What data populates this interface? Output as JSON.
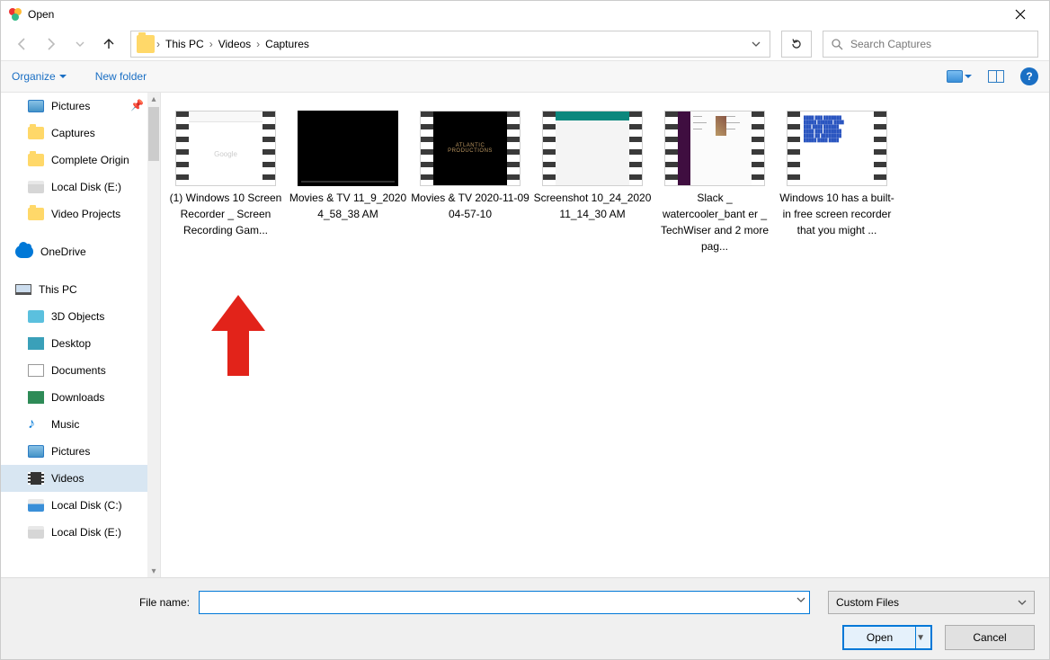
{
  "window": {
    "title": "Open"
  },
  "address": {
    "crumbs": [
      "This PC",
      "Videos",
      "Captures"
    ]
  },
  "search": {
    "placeholder": "Search Captures"
  },
  "toolbar": {
    "organize": "Organize",
    "newfolder": "New folder"
  },
  "sidebar": {
    "group1": [
      {
        "label": "Pictures",
        "icon": "pic",
        "pinned": true
      },
      {
        "label": "Captures",
        "icon": "folder"
      },
      {
        "label": "Complete Origin",
        "icon": "folder"
      },
      {
        "label": "Local Disk (E:)",
        "icon": "disk"
      },
      {
        "label": "Video Projects",
        "icon": "folder"
      }
    ],
    "onedrive": "OneDrive",
    "thispc": "This PC",
    "group2": [
      {
        "label": "3D Objects",
        "icon": "3d"
      },
      {
        "label": "Desktop",
        "icon": "desk"
      },
      {
        "label": "Documents",
        "icon": "doc"
      },
      {
        "label": "Downloads",
        "icon": "dl"
      },
      {
        "label": "Music",
        "icon": "music"
      },
      {
        "label": "Pictures",
        "icon": "pic"
      },
      {
        "label": "Videos",
        "icon": "vid",
        "selected": true
      },
      {
        "label": "Local Disk (C:)",
        "icon": "diskc"
      },
      {
        "label": "Local Disk (E:)",
        "icon": "disk"
      }
    ]
  },
  "files": [
    {
      "name": "(1) Windows 10 Screen Recorder _ Screen Recording Gam...",
      "thumb": "browser"
    },
    {
      "name": "Movies & TV 11_9_2020 4_58_38 AM",
      "thumb": "player"
    },
    {
      "name": "Movies & TV 2020-11-09 04-57-10",
      "thumb": "dark"
    },
    {
      "name": "Screenshot 10_24_2020 11_14_30 AM",
      "thumb": "web"
    },
    {
      "name": "Slack _ watercooler_bant er _ TechWiser and 2 more pag...",
      "thumb": "slack"
    },
    {
      "name": "Windows 10 has a built-in free screen recorder that you might ...",
      "thumb": "text"
    }
  ],
  "bottom": {
    "filename_label": "File name:",
    "filter": "Custom Files",
    "open": "Open",
    "cancel": "Cancel"
  }
}
